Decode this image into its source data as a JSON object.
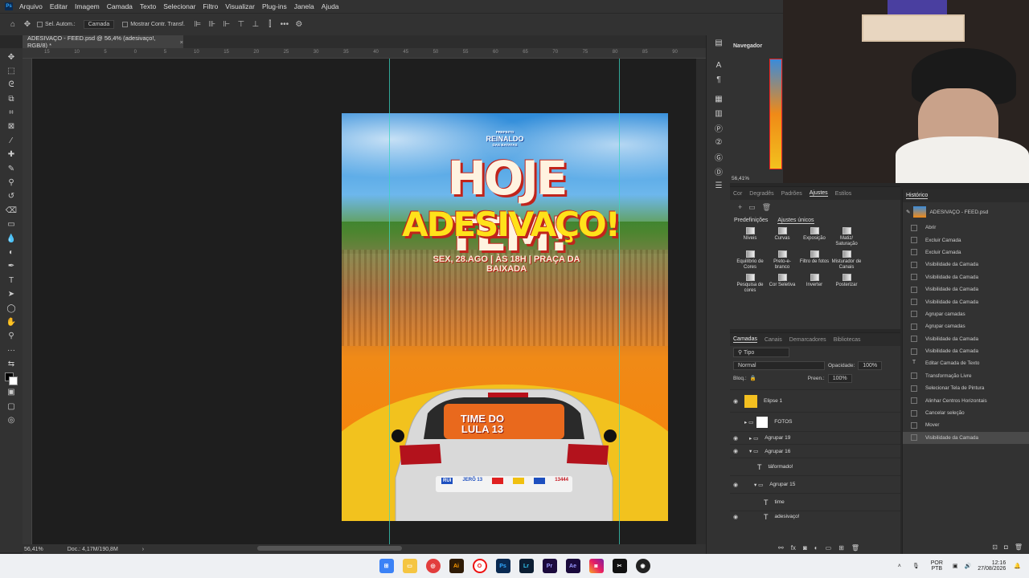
{
  "menu": {
    "items": [
      "Arquivo",
      "Editar",
      "Imagem",
      "Camada",
      "Texto",
      "Selecionar",
      "Filtro",
      "Visualizar",
      "Plug-ins",
      "Janela",
      "Ajuda"
    ]
  },
  "options": {
    "auto_select": "Sel. Autom.:",
    "target": "Camada",
    "show_transform": "Mostrar Contr. Transf."
  },
  "document": {
    "tab_title": "ADESIVAÇO - FEED.psd @ 56,4% (adesivaço!, RGB/8) *"
  },
  "ruler": {
    "ticks": [
      "15",
      "10",
      "5",
      "0",
      "5",
      "10",
      "15",
      "20",
      "25",
      "30",
      "35",
      "40",
      "45",
      "50",
      "55",
      "60",
      "65",
      "70",
      "75",
      "80",
      "85",
      "90"
    ]
  },
  "status": {
    "zoom": "56,41%",
    "doc": "Doc.: 4,17M/190,8M"
  },
  "poster": {
    "logo_top": "PREFEITO",
    "logo_name": "REINALDO",
    "logo_sub": "DAS BATATAS",
    "headline1": "HOJE TEM!",
    "headline2": "ADESIVAÇO!",
    "event": "SEX, 28.AGO | ÀS 18H | PRAÇA DA BAIXADA",
    "window_text1": "TIME DO",
    "window_text2": "LULA 13",
    "stickers": [
      "RUI",
      "JERÔ 13",
      "",
      "",
      "",
      "13444"
    ]
  },
  "navigator": {
    "title": "Navegador",
    "zoom": "56,41%"
  },
  "adjustments": {
    "tabs": [
      "Cor",
      "Degradês",
      "Padrões",
      "Ajustes",
      "Estilos"
    ],
    "sub_tabs": [
      "Predefinições",
      "Ajustes únicos"
    ],
    "items": [
      "Níveis",
      "Curvas",
      "Exposição",
      "Matiz/ Saturação",
      "Equilíbrio de Cores",
      "Preto-e-branco",
      "Filtro de fotos",
      "Misturador de Canais",
      "Pesquisa de cores",
      "Cor Seletiva",
      "Inverter",
      "Posterizar"
    ]
  },
  "layers": {
    "tabs": [
      "Camadas",
      "Canais",
      "Demarcadores",
      "Bibliotecas"
    ],
    "filter": "Tipo",
    "blend": "Normal",
    "opacity_label": "Opacidade:",
    "opacity": "100%",
    "lock_label": "Bloq.:",
    "fill_label": "Preen.:",
    "fill": "100%",
    "items": [
      {
        "name": "Elipse 1",
        "kind": "shape"
      },
      {
        "name": "FOTOS",
        "kind": "group-mask"
      },
      {
        "name": "Agrupar 19",
        "kind": "group"
      },
      {
        "name": "Agrupar 16",
        "kind": "group"
      },
      {
        "name": "táformado!",
        "kind": "text"
      },
      {
        "name": "Agrupar 15",
        "kind": "group"
      },
      {
        "name": "time",
        "kind": "text"
      },
      {
        "name": "adesivaço!",
        "kind": "text"
      }
    ]
  },
  "history": {
    "title": "Histórico",
    "snapshot": "ADESIVAÇO - FEED.psd",
    "items": [
      "Abrir",
      "Excluir Camada",
      "Excluir Camada",
      "Visibilidade da Camada",
      "Visibilidade da Camada",
      "Visibilidade da Camada",
      "Visibilidade da Camada",
      "Agrupar camadas",
      "Agrupar camadas",
      "Visibilidade da Camada",
      "Visibilidade da Camada",
      "Editar Camada de Texto",
      "Transformação Livre",
      "Selecionar Tela de Pintura",
      "Alinhar Centros Horizontais",
      "Cancelar seleção",
      "Mover",
      "Visibilidade da Camada"
    ]
  },
  "taskbar": {
    "lang1": "POR",
    "lang2": "PTB",
    "time": "12:16",
    "date": "27/08/2026"
  },
  "colors": {
    "accent": "#31a8ff",
    "guide": "#3ad6c2",
    "poster_red": "#c0241c",
    "poster_yellow": "#ffe21a"
  }
}
